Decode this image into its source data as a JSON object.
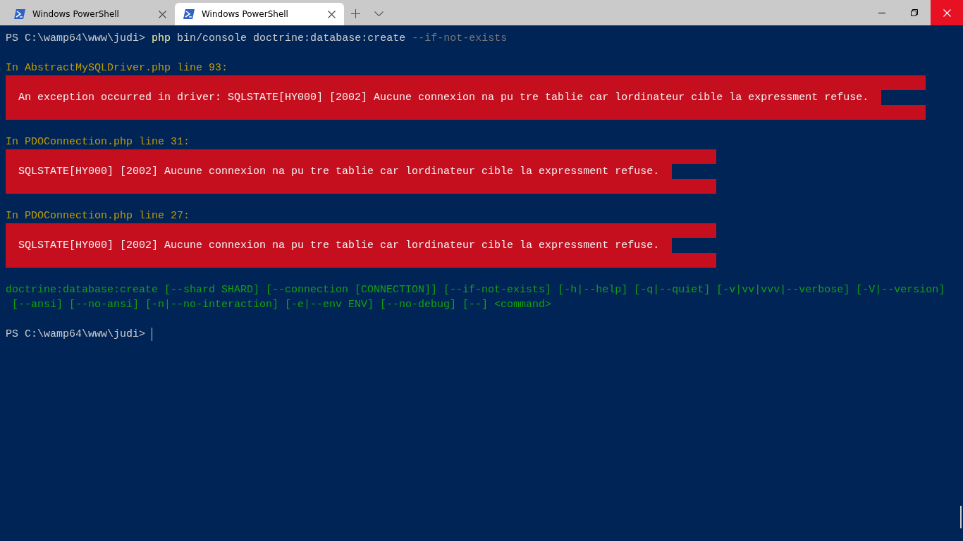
{
  "tabs": [
    {
      "title": "Windows PowerShell",
      "selected": false
    },
    {
      "title": "Windows PowerShell",
      "selected": true
    }
  ],
  "terminal": {
    "lines": [
      {
        "kind": "command",
        "prompt": "PS C:\\wamp64\\www\\judi>",
        "program": "php",
        "args": "bin/console doctrine:database:create",
        "flag": "--if-not-exists"
      },
      {
        "kind": "blank"
      },
      {
        "kind": "location",
        "text": "In AbstractMySQLDriver.php line 93:"
      },
      {
        "kind": "error",
        "text": "An exception occurred in driver: SQLSTATE[HY000] [2002] Aucune connexion na pu tre tablie car lordinateur cible la expressment refuse."
      },
      {
        "kind": "blank"
      },
      {
        "kind": "location",
        "text": "In PDOConnection.php line 31:"
      },
      {
        "kind": "error",
        "text": "SQLSTATE[HY000] [2002] Aucune connexion na pu tre tablie car lordinateur cible la expressment refuse."
      },
      {
        "kind": "blank"
      },
      {
        "kind": "location",
        "text": "In PDOConnection.php line 27:"
      },
      {
        "kind": "error",
        "text": "SQLSTATE[HY000] [2002] Aucune connexion na pu tre tablie car lordinateur cible la expressment refuse."
      },
      {
        "kind": "blank"
      },
      {
        "kind": "usage",
        "text": "doctrine:database:create [--shard SHARD] [--connection [CONNECTION]] [--if-not-exists] [-h|--help] [-q|--quiet] [-v|vv|vvv|--verbose] [-V|--version]"
      },
      {
        "kind": "usage",
        "text": " [--ansi] [--no-ansi] [-n|--no-interaction] [-e|--env ENV] [--no-debug] [--] <command>"
      },
      {
        "kind": "blank"
      },
      {
        "kind": "prompt",
        "prompt": "PS C:\\wamp64\\www\\judi>",
        "cursor": true
      }
    ]
  }
}
